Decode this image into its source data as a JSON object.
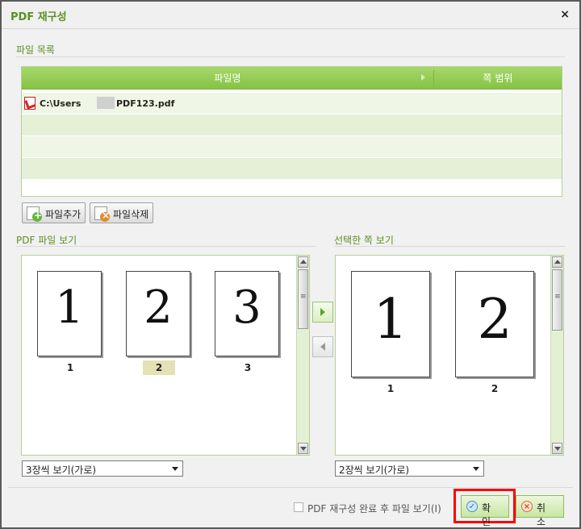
{
  "window": {
    "title": "PDF 재구성",
    "close_glyph": "×"
  },
  "file_list": {
    "section_label": "파일 목록",
    "col_filename": "파일명",
    "col_page_range": "쪽 범위",
    "files": [
      {
        "prefix": "C:\\Users",
        "name": "PDF123.pdf",
        "page_range": ""
      }
    ]
  },
  "file_buttons": {
    "add": "파일추가",
    "delete": "파일삭제"
  },
  "pdf_viewer": {
    "section_label": "PDF 파일 보기",
    "pages": [
      {
        "number": "1",
        "caption": "1"
      },
      {
        "number": "2",
        "caption": "2"
      },
      {
        "number": "3",
        "caption": "3"
      }
    ],
    "selected_caption": "2",
    "view_mode": "3장씩 보기(가로)"
  },
  "selected_viewer": {
    "section_label": "선택한 쪽 보기",
    "pages": [
      {
        "number": "1",
        "caption": "1"
      },
      {
        "number": "2",
        "caption": "2"
      }
    ],
    "view_mode": "2장씩 보기(가로)"
  },
  "footer": {
    "open_after_label": "PDF 재구성 완료 후 파일 보기(I)",
    "open_after_checked": false,
    "ok": "확 인",
    "cancel": "취 소"
  },
  "colors": {
    "accent_green": "#86c244",
    "label_green": "#5b8f22",
    "highlight_red": "#ff0000"
  }
}
